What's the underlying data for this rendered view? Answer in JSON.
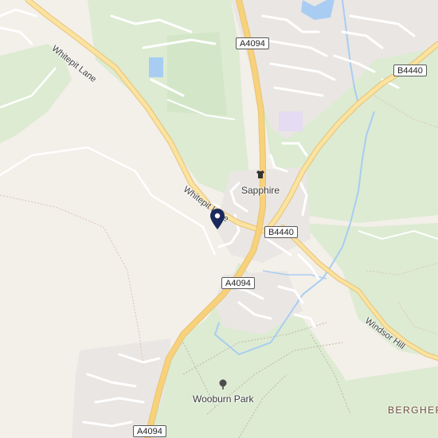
{
  "road_shields": {
    "a4094_top": "A4094",
    "b4440_top": "B4440",
    "b4440_center": "B4440",
    "a4094_mid": "A4094",
    "a4094_bottom": "A4094"
  },
  "road_names": {
    "whitepit_upper": "Whitepit Lane",
    "whitepit_lower": "Whitepit Lane",
    "windsor_hill": "Windsor Hill"
  },
  "places": {
    "sapphire": "Sapphire",
    "wooburn_park": "Wooburn Park",
    "bergher": "BERGHER"
  },
  "icons": {
    "sapphire": "clothing-store-icon",
    "wooburn_park": "tree-park-icon",
    "pin": "location-pin-icon"
  },
  "colors": {
    "background": "#f3efe9",
    "woodland": "#dcebd2",
    "road_major": "#f7d27a",
    "water": "#a9cdf2",
    "pin": "#1b2a5c"
  }
}
